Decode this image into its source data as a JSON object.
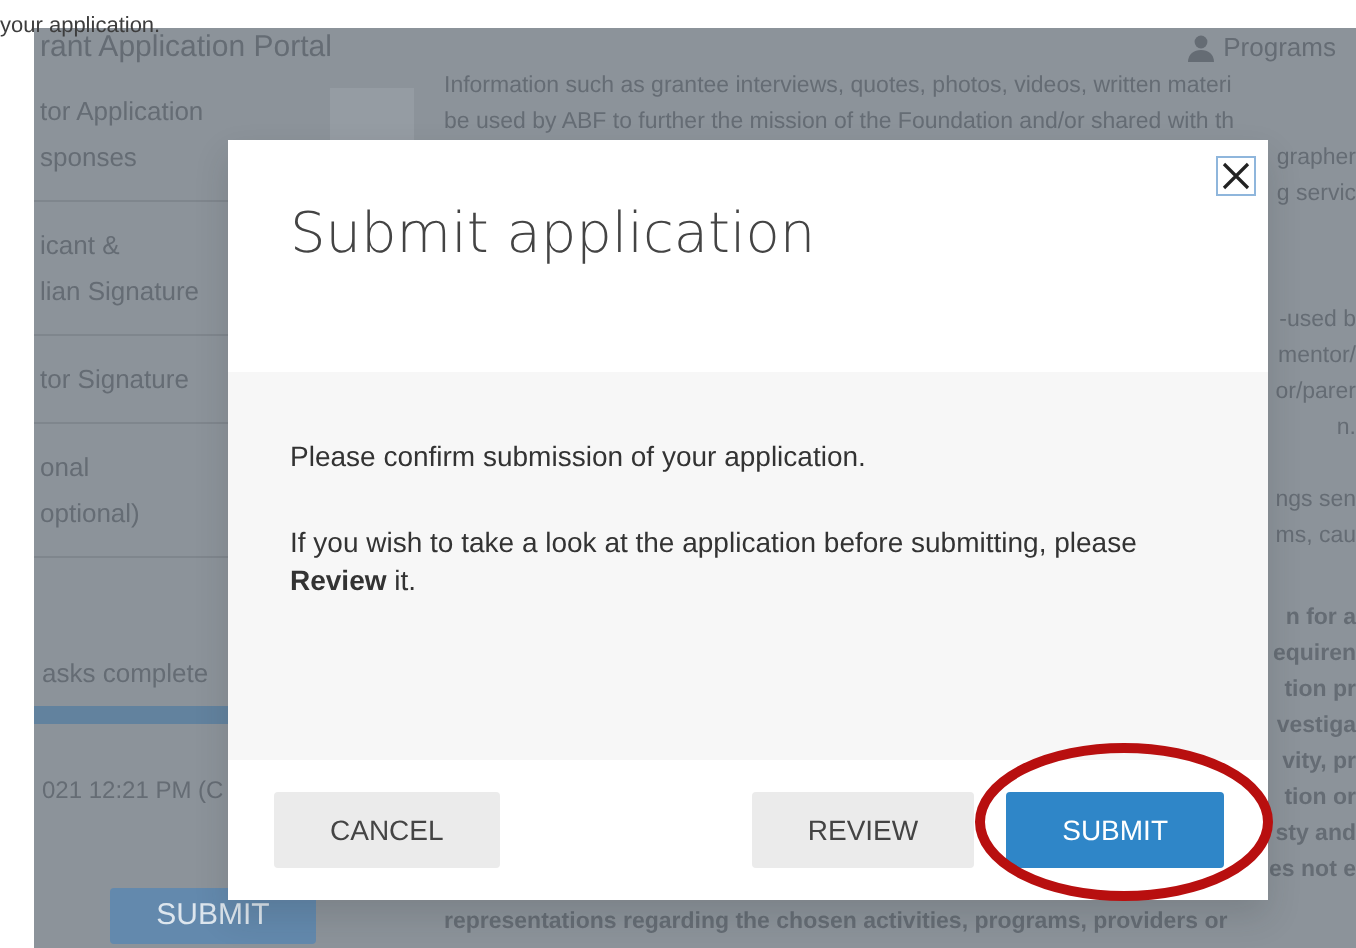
{
  "heading_fragment": "your application.",
  "portal": {
    "title": "rant Application Portal",
    "programs_link": "Programs"
  },
  "sidebar": {
    "items": [
      {
        "lines": [
          "tor Application",
          "sponses"
        ]
      },
      {
        "lines": [
          "icant &",
          "lian Signature"
        ]
      },
      {
        "lines": [
          "tor Signature"
        ]
      },
      {
        "lines": [
          "onal",
          "optional)"
        ]
      }
    ],
    "progress_label": "asks complete",
    "progress": {
      "level": 1
    },
    "timestamp": "021 12:21 PM (C",
    "submit_button": "SUBMIT"
  },
  "content": {
    "paragraphs": [
      {
        "bold": false,
        "lines": [
          {
            "kind": "full",
            "text": "Information such as grantee interviews, quotes, photos, videos, written materi"
          },
          {
            "kind": "full",
            "text": "be used by ABF to further the mission of the Foundation and/or shared with th"
          },
          {
            "kind": "tail",
            "text": "grapher"
          },
          {
            "kind": "tail",
            "text": "g servic"
          }
        ]
      },
      {
        "bold": false,
        "lines": [
          {
            "kind": "tail",
            "text": "-used b"
          },
          {
            "kind": "tail",
            "text": "mentor/"
          },
          {
            "kind": "tail",
            "text": "or/parer"
          },
          {
            "kind": "tail",
            "text": "n."
          }
        ]
      },
      {
        "bold": false,
        "lines": [
          {
            "kind": "tail",
            "text": "ngs sen"
          },
          {
            "kind": "tail",
            "text": "ms, cau"
          }
        ]
      },
      {
        "bold": true,
        "lines": [
          {
            "kind": "tail",
            "text": "n for a"
          },
          {
            "kind": "tail",
            "text": "equiren"
          },
          {
            "kind": "tail",
            "text": "tion pr"
          },
          {
            "kind": "tail",
            "text": "vestiga"
          },
          {
            "kind": "tail",
            "text": "vity, pr"
          },
          {
            "kind": "tail",
            "text": "tion or"
          },
          {
            "kind": "tail",
            "text": "sty and"
          },
          {
            "kind": "tail",
            "text": "es not e"
          },
          {
            "kind": "full",
            "text": "representations regarding the chosen activities, programs, providers or"
          }
        ]
      }
    ]
  },
  "modal": {
    "title": "Submit application",
    "paragraphs": [
      "Please confirm submission of your application.",
      "If you wish to take a look at the application before submitting, please **Review** it."
    ],
    "buttons": [
      {
        "label": "CANCEL",
        "kind": "dismiss"
      },
      {
        "label": "REVIEW",
        "kind": "default"
      },
      {
        "label": "SUBMIT",
        "kind": "primary"
      }
    ]
  },
  "annotation": {
    "kind": "ellipse"
  }
}
